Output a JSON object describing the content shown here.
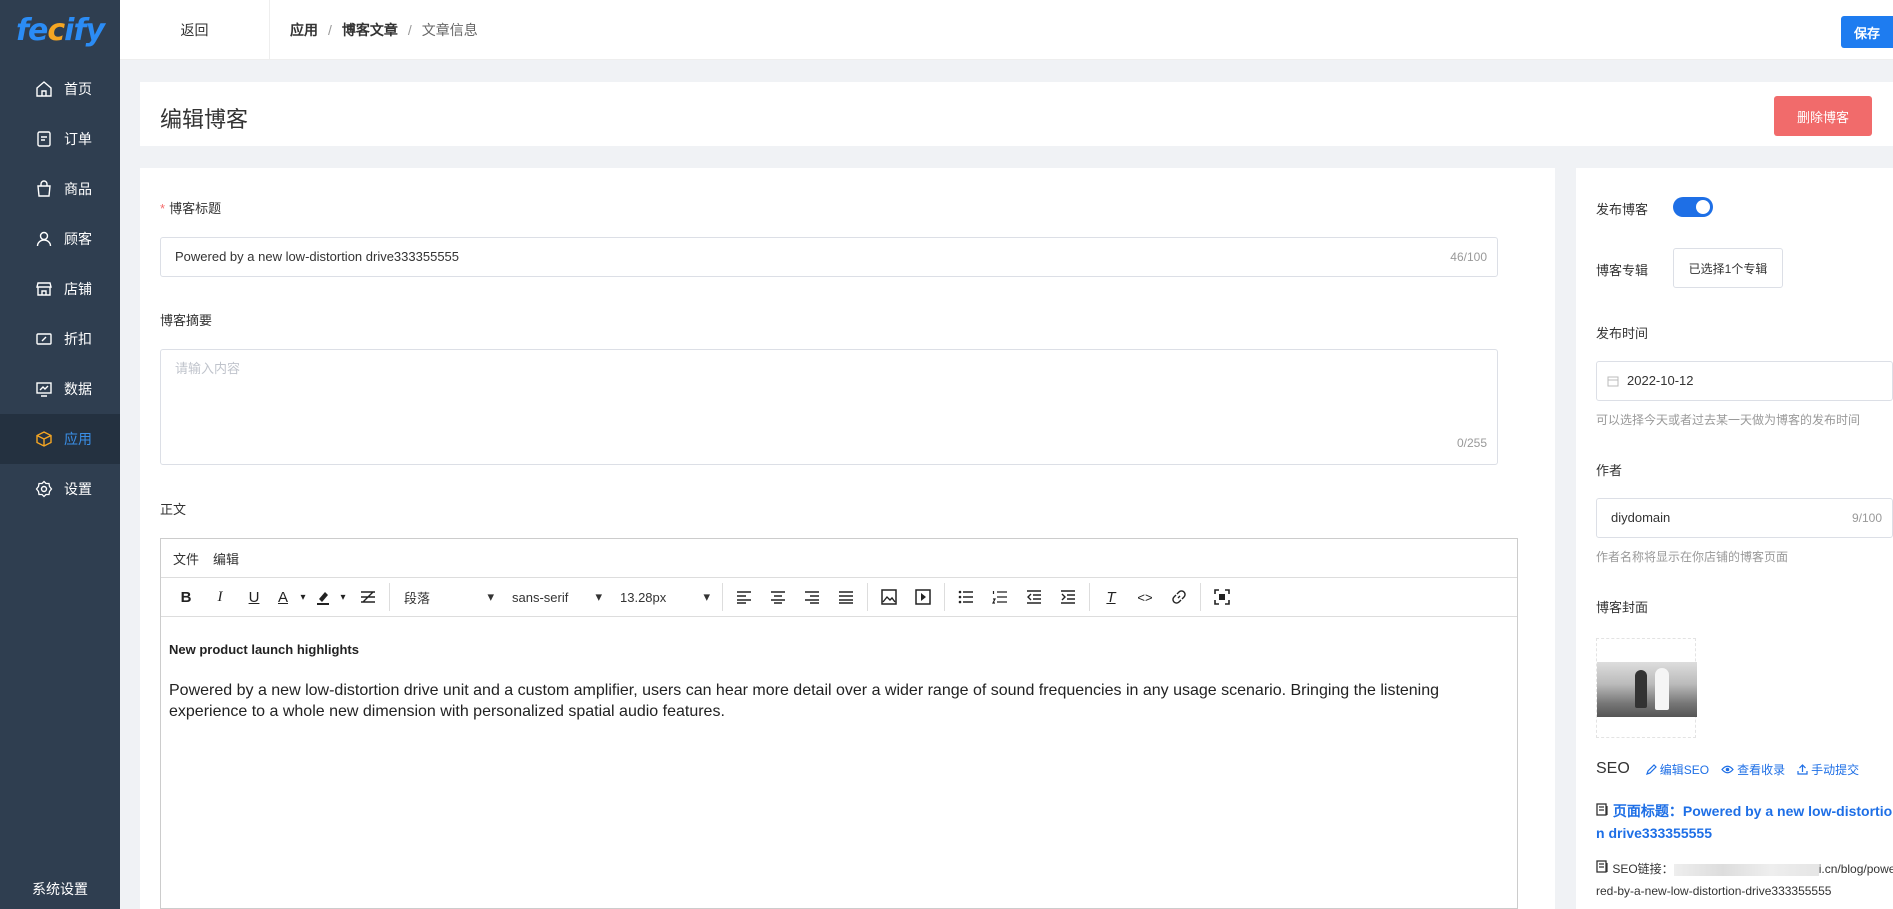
{
  "brand": {
    "logo_text_1": "fe",
    "logo_text_2": "c",
    "logo_text_3": "ify"
  },
  "sidebar": {
    "items": [
      {
        "label": "首页",
        "icon": "home-icon"
      },
      {
        "label": "订单",
        "icon": "order-icon"
      },
      {
        "label": "商品",
        "icon": "bag-icon"
      },
      {
        "label": "顾客",
        "icon": "user-icon"
      },
      {
        "label": "店铺",
        "icon": "store-icon"
      },
      {
        "label": "折扣",
        "icon": "discount-icon"
      },
      {
        "label": "数据",
        "icon": "chart-icon"
      },
      {
        "label": "应用",
        "icon": "cube-icon",
        "active": true
      },
      {
        "label": "设置",
        "icon": "gear-icon"
      }
    ],
    "bottom": "系统设置"
  },
  "topbar": {
    "back": "返回",
    "breadcrumb": [
      "应用",
      "博客文章",
      "文章信息"
    ],
    "save": "保存"
  },
  "header": {
    "title": "编辑博客",
    "delete": "删除博客"
  },
  "form": {
    "title_label": "博客标题",
    "title_value": "Powered by a new low-distortion drive333355555",
    "title_count": "46/100",
    "summary_label": "博客摘要",
    "summary_placeholder": "请输入内容",
    "summary_count": "0/255",
    "body_label": "正文"
  },
  "editor": {
    "menu": [
      "文件",
      "编辑"
    ],
    "paragraph": "段落",
    "font": "sans-serif",
    "size": "13.28px",
    "heading": "New product launch highlights",
    "body": "Powered by a new low-distortion drive unit and a custom amplifier, users can hear more detail over a wider range of sound frequencies in any usage scenario. Bringing the listening experience to a whole new dimension with personalized spatial audio features."
  },
  "side": {
    "publish_label": "发布博客",
    "publish_on": true,
    "album_label": "博客专辑",
    "album_button": "已选择1个专辑",
    "time_label": "发布时间",
    "time_value": "2022-10-12",
    "time_hint": "可以选择今天或者过去某一天做为博客的发布时间",
    "author_label": "作者",
    "author_value": "diydomain",
    "author_count": "9/100",
    "author_hint": "作者名称将显示在你店铺的博客页面",
    "cover_label": "博客封面",
    "seo_label": "SEO",
    "seo_edit": "编辑SEO",
    "seo_view": "查看收录",
    "seo_submit": "手动提交",
    "seo_title_prefix": "页面标题：",
    "seo_title": "Powered by a new low-distortion drive333355555",
    "seo_url_prefix": "SEO链接：",
    "seo_url_tail": "i.cn/blog/powered-by-a-new-low-distortion-drive333355555"
  },
  "colors": {
    "sidebar": "#2f3e50",
    "accent": "#1e7cf0",
    "danger": "#f16b6b"
  }
}
